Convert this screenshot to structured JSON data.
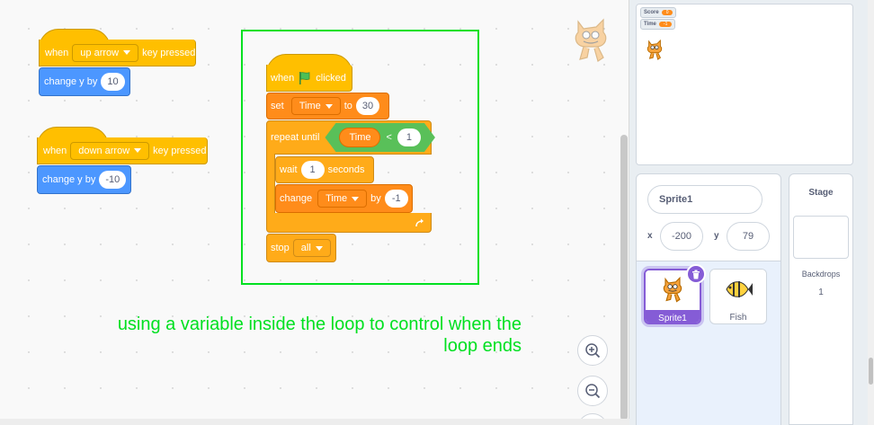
{
  "script_up": {
    "hat": {
      "when": "when",
      "key": "up arrow",
      "pressed": "key pressed"
    },
    "change": {
      "label": "change y by",
      "value": "10"
    }
  },
  "script_down": {
    "hat": {
      "when": "when",
      "key": "down arrow",
      "pressed": "key pressed"
    },
    "change": {
      "label": "change y by",
      "value": "-10"
    }
  },
  "main_script": {
    "hat": {
      "when": "when",
      "clicked": "clicked",
      "icon": "green-flag-icon"
    },
    "set": {
      "label": "set",
      "variable": "Time",
      "to": "to",
      "value": "30"
    },
    "repeat": {
      "label": "repeat until",
      "operand": "Time",
      "operator": "<",
      "value": "1"
    },
    "wait": {
      "label": "wait",
      "value": "1",
      "unit": "seconds"
    },
    "change": {
      "label": "change",
      "variable": "Time",
      "by": "by",
      "value": "-1"
    },
    "loop_icon": "loop-arrow-icon",
    "stop": {
      "label": "stop",
      "option": "all"
    }
  },
  "caption": {
    "line1": "using a variable inside the loop to control when the",
    "line2": "loop ends"
  },
  "zoom": {
    "in_icon": "zoom-in-icon",
    "out_icon": "zoom-out-icon",
    "reset_icon": "zoom-reset-icon"
  },
  "stage": {
    "monitors": [
      {
        "name": "Score",
        "value": "0"
      },
      {
        "name": "Time",
        "value": "-1"
      }
    ]
  },
  "sprite_info": {
    "name": "Sprite1",
    "x_label": "x",
    "x": "-200",
    "y_label": "y",
    "y": "79"
  },
  "sprites": [
    {
      "name": "Sprite1",
      "selected": true
    },
    {
      "name": "Fish",
      "selected": false
    }
  ],
  "stage_panel": {
    "title": "Stage",
    "backdrops_label": "Backdrops",
    "backdrops_count": "1"
  },
  "colors": {
    "events": "#ffbf00",
    "motion": "#4c97ff",
    "variables": "#ff8c1a",
    "control": "#ffab19",
    "operators": "#59c059",
    "highlight": "#00e020",
    "selected": "#855cd6"
  }
}
